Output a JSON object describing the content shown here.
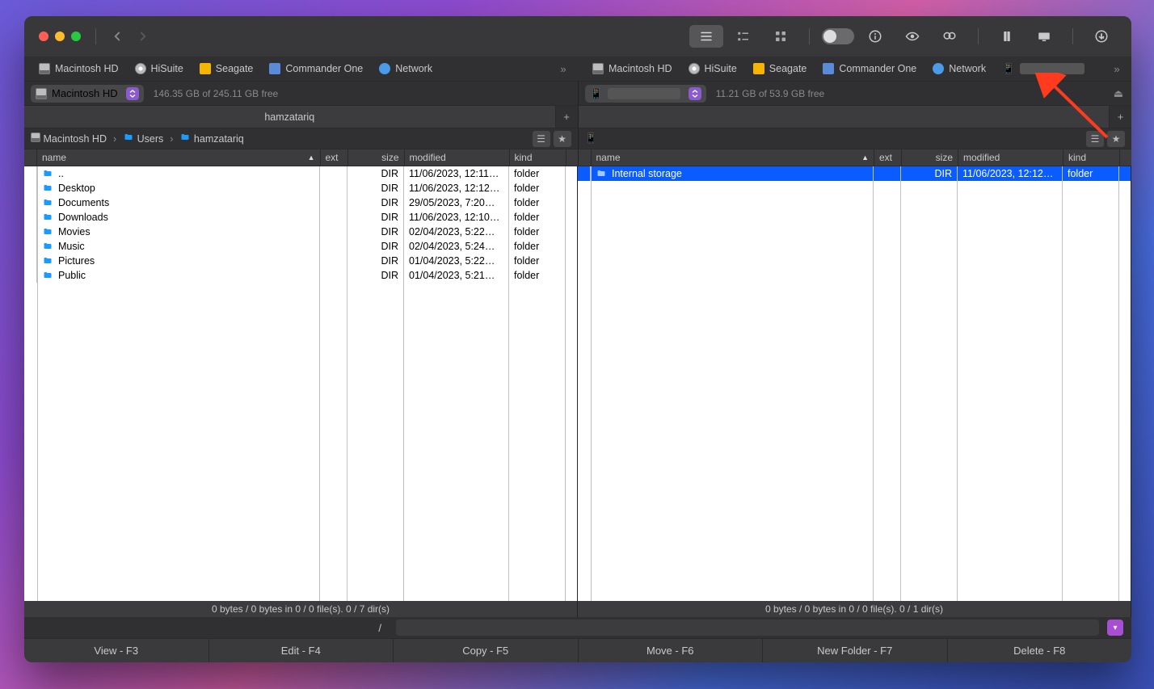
{
  "locations": [
    {
      "label": "Macintosh HD",
      "icon": "disk"
    },
    {
      "label": "HiSuite",
      "icon": "cd"
    },
    {
      "label": "Seagate",
      "icon": "ext"
    },
    {
      "label": "Commander One",
      "icon": "app"
    },
    {
      "label": "Network",
      "icon": "net"
    }
  ],
  "left": {
    "drive": "Macintosh HD",
    "free": "146.35 GB of 245.11 GB free",
    "tab": "hamzatariq",
    "breadcrumb": [
      "Macintosh HD",
      "Users",
      "hamzatariq"
    ],
    "columns": {
      "name": "name",
      "ext": "ext",
      "size": "size",
      "mod": "modified",
      "kind": "kind"
    },
    "rows": [
      {
        "name": "..",
        "size": "DIR",
        "mod": "11/06/2023, 12:11…",
        "kind": "folder"
      },
      {
        "name": "Desktop",
        "size": "DIR",
        "mod": "11/06/2023, 12:12…",
        "kind": "folder"
      },
      {
        "name": "Documents",
        "size": "DIR",
        "mod": "29/05/2023, 7:20…",
        "kind": "folder"
      },
      {
        "name": "Downloads",
        "size": "DIR",
        "mod": "11/06/2023, 12:10…",
        "kind": "folder"
      },
      {
        "name": "Movies",
        "size": "DIR",
        "mod": "02/04/2023, 5:22…",
        "kind": "folder"
      },
      {
        "name": "Music",
        "size": "DIR",
        "mod": "02/04/2023, 5:24…",
        "kind": "folder"
      },
      {
        "name": "Pictures",
        "size": "DIR",
        "mod": "01/04/2023, 5:22…",
        "kind": "folder"
      },
      {
        "name": "Public",
        "size": "DIR",
        "mod": "01/04/2023, 5:21…",
        "kind": "folder"
      }
    ],
    "status": "0 bytes / 0 bytes in 0 / 0 file(s). 0 / 7 dir(s)"
  },
  "right": {
    "drive": "",
    "free": "11.21 GB of 53.9 GB free",
    "tab": "",
    "breadcrumb_icon": "phone",
    "columns": {
      "name": "name",
      "ext": "ext",
      "size": "size",
      "mod": "modified",
      "kind": "kind"
    },
    "rows": [
      {
        "name": "Internal storage",
        "size": "DIR",
        "mod": "11/06/2023, 12:12…",
        "kind": "folder",
        "selected": true
      }
    ],
    "status": "0 bytes / 0 bytes in 0 / 0 file(s). 0 / 1 dir(s)"
  },
  "cmdline_path": "/",
  "fnbar": [
    "View - F3",
    "Edit - F4",
    "Copy - F5",
    "Move - F6",
    "New Folder - F7",
    "Delete - F8"
  ]
}
